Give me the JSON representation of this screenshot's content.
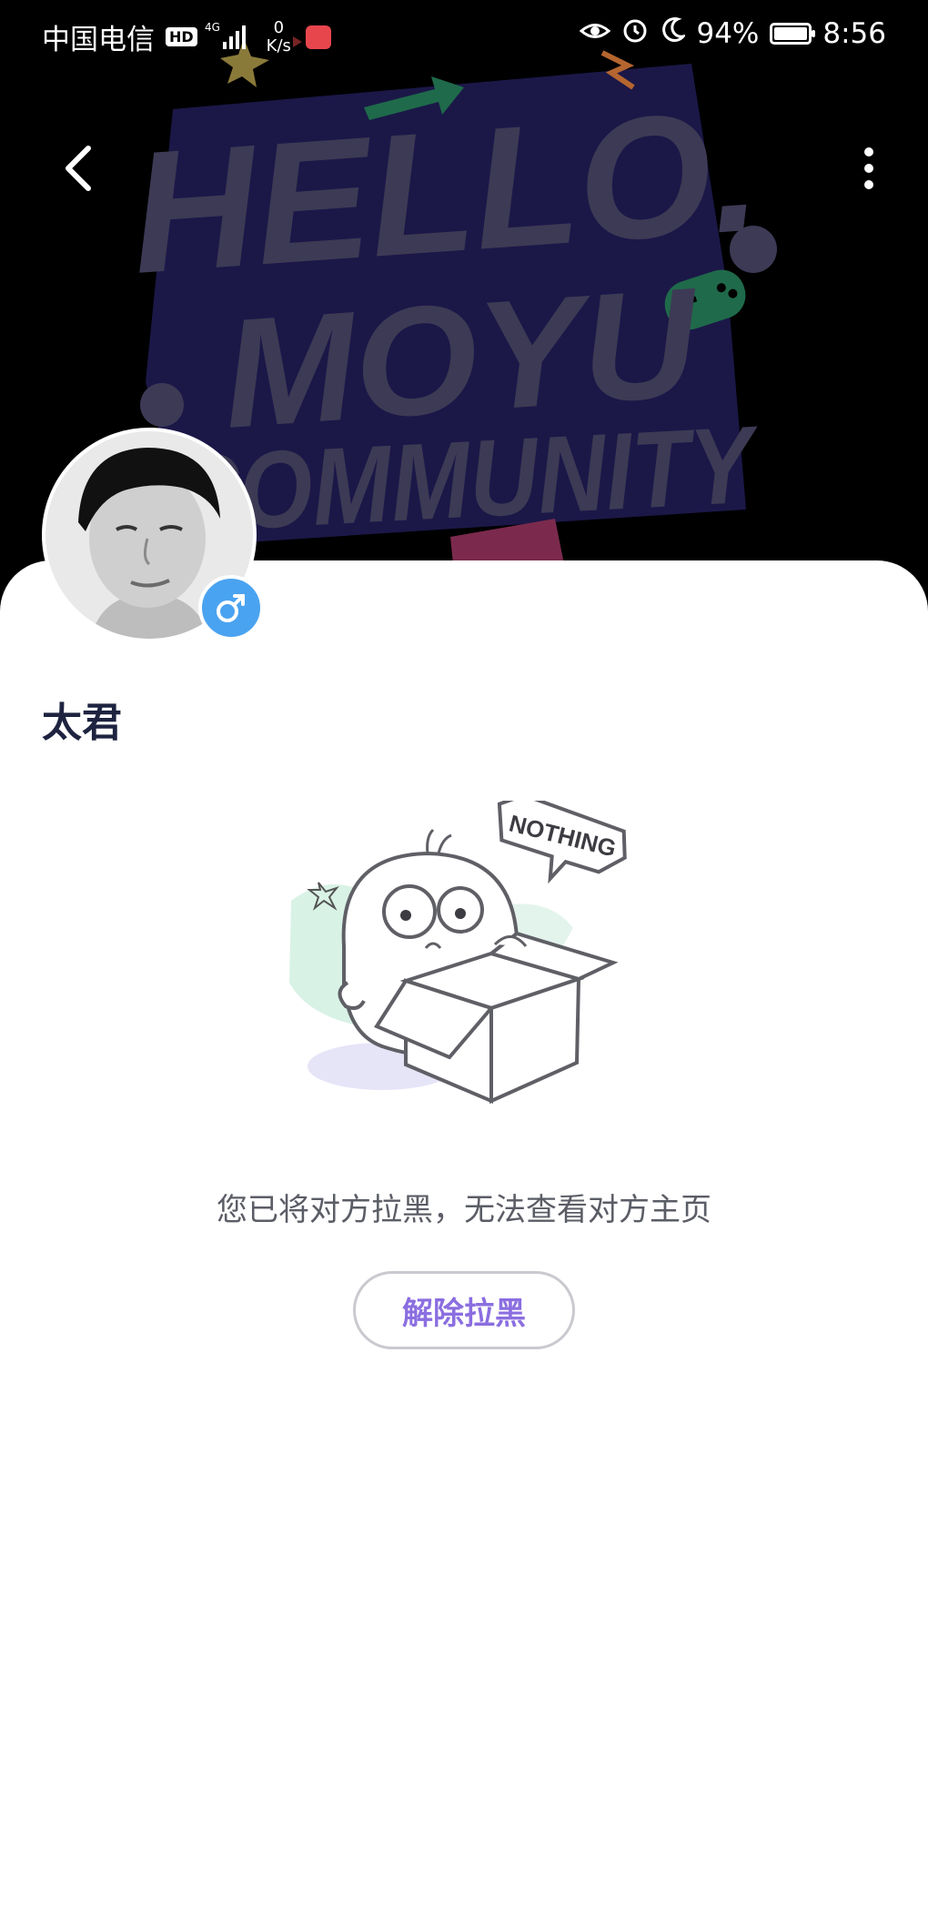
{
  "status_bar": {
    "carrier": "中国电信",
    "hd": "HD",
    "network_type": "4G",
    "net_speed_value": "0",
    "net_speed_unit": "K/s",
    "battery_percent": "94%",
    "time": "8:56"
  },
  "banner": {
    "line1": "HELLO.",
    "line2": "MOYU",
    "line3": "COMMUNITY"
  },
  "profile": {
    "username": "太君",
    "gender": "male"
  },
  "empty_state": {
    "badge_text": "NOTHING",
    "message": "您已将对方拉黑，无法查看对方主页",
    "unblock_label": "解除拉黑"
  },
  "colors": {
    "accent": "#8b6ee0",
    "gender_badge": "#4aa3f0",
    "banner_text": "#3d3a55",
    "banner_bg_shape": "#1b1848"
  }
}
